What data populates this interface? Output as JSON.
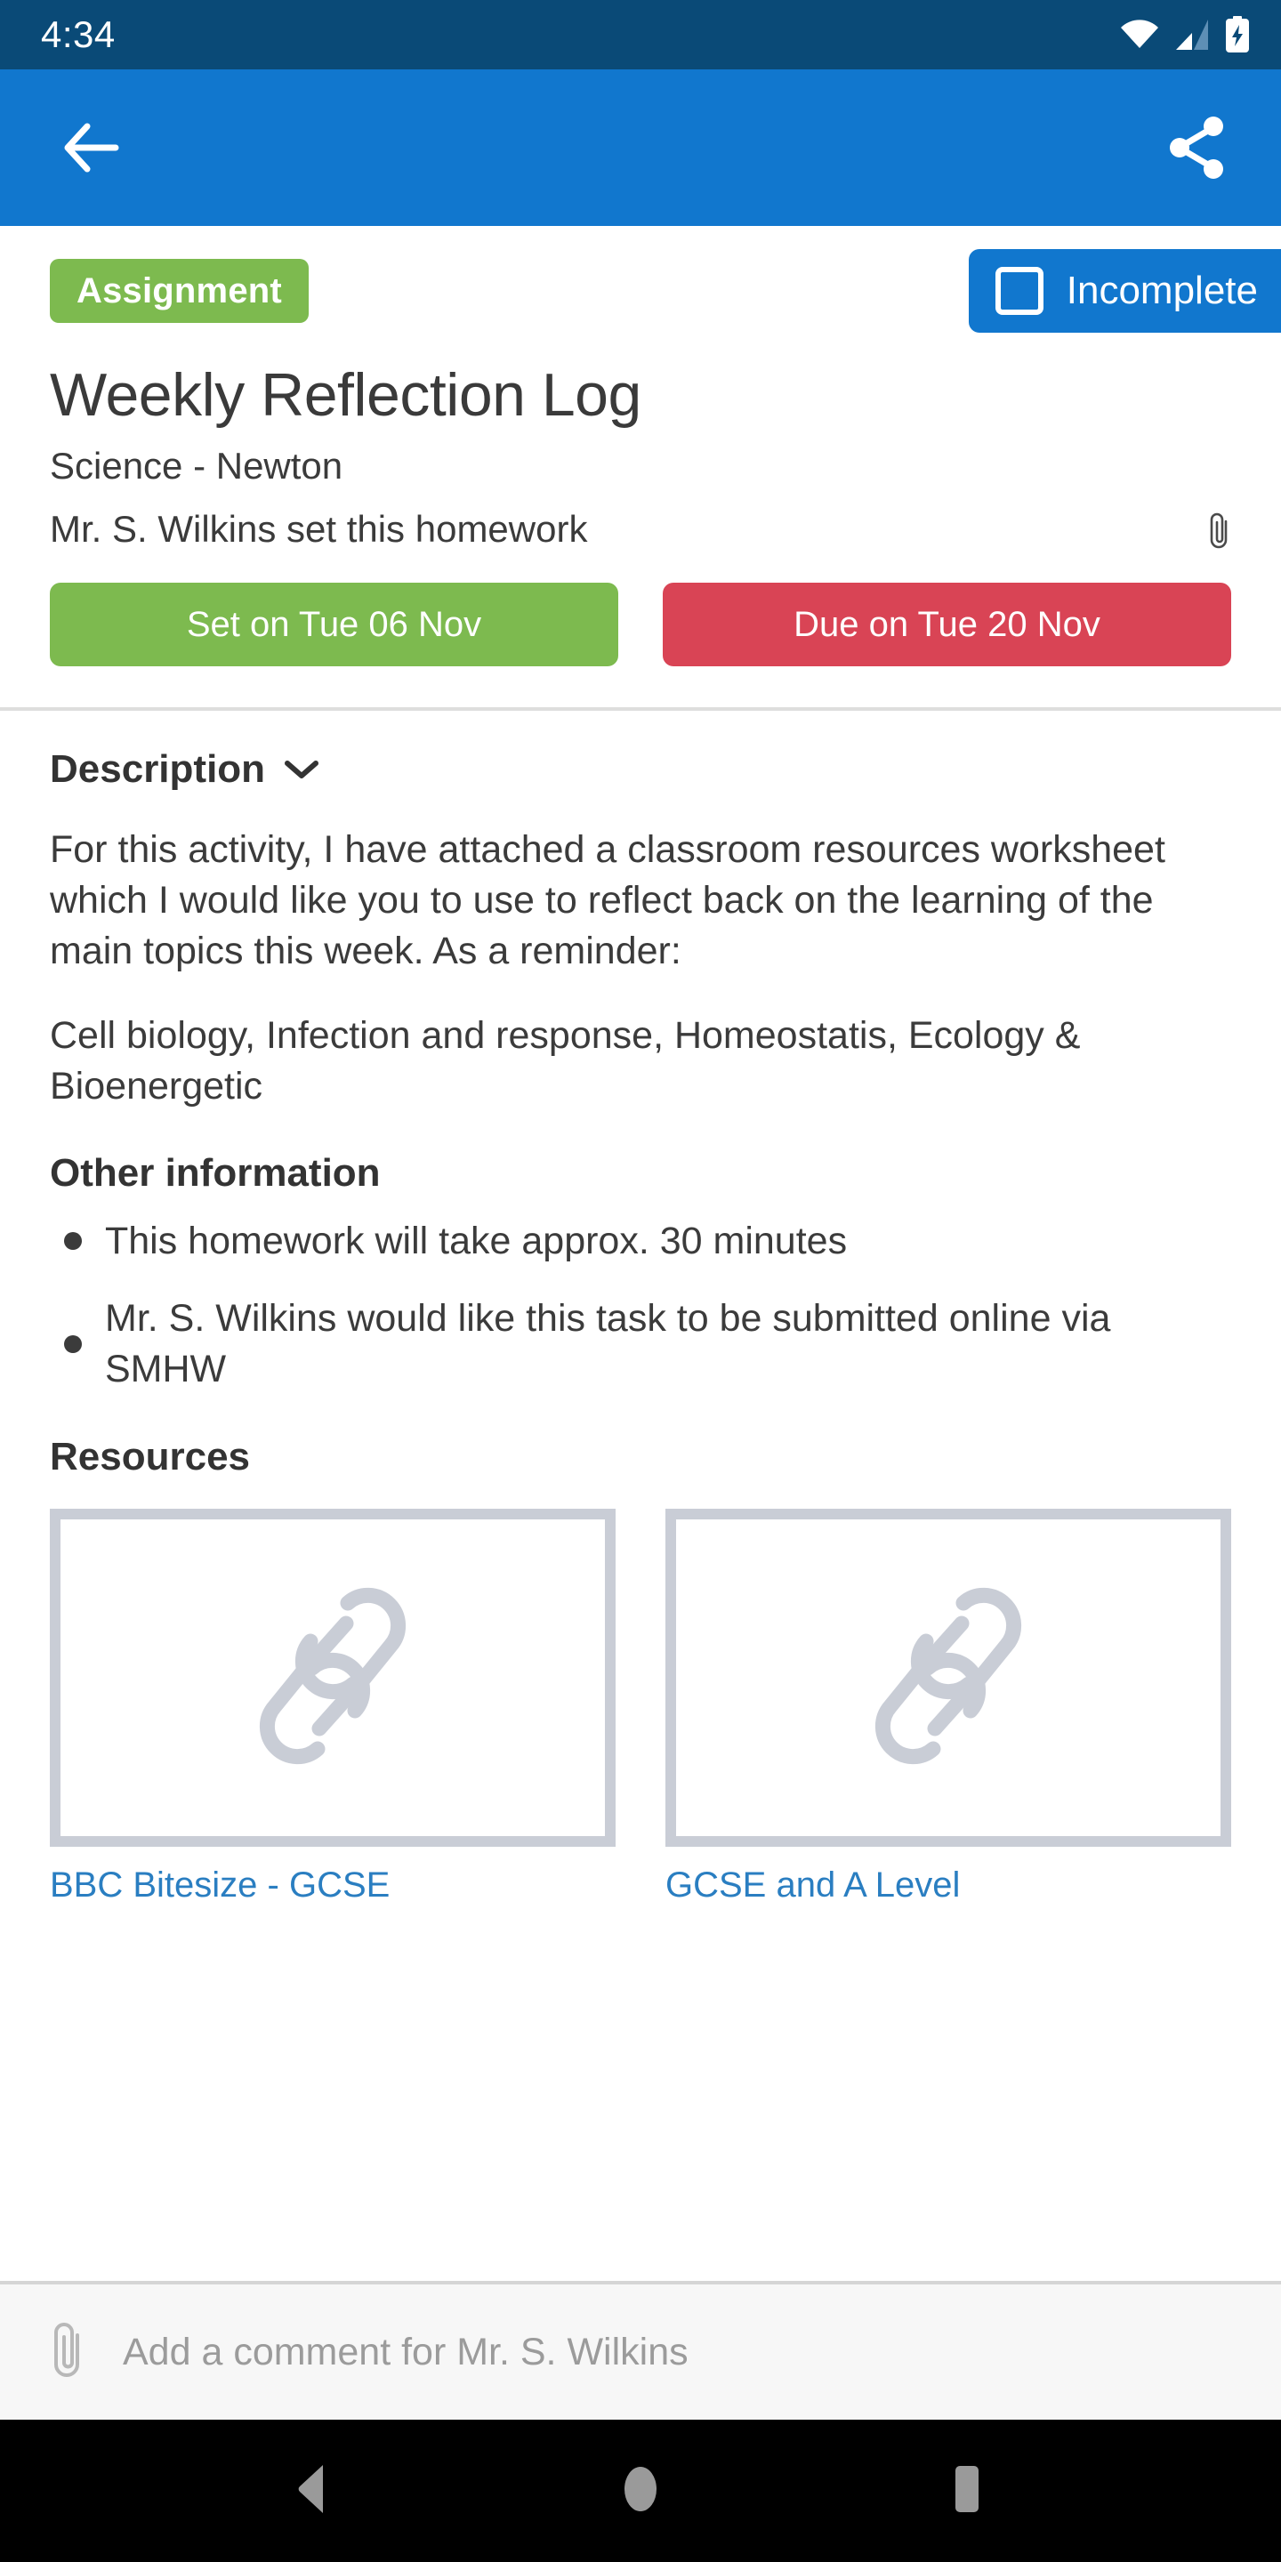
{
  "status_bar": {
    "time": "4:34",
    "icons": [
      "wifi-icon",
      "cellular-signal-icon",
      "battery-charging-icon"
    ],
    "background": "#0a4a77"
  },
  "app_bar": {
    "background": "#1177ce",
    "back_icon": "back-arrow-icon",
    "share_icon": "share-icon"
  },
  "homework": {
    "type_badge": "Assignment",
    "type_badge_color": "#7dba4f",
    "completion_status": "Incomplete",
    "completion_status_color": "#1177ce",
    "title": "Weekly Reflection Log",
    "subject": "Science - Newton",
    "setter_line": "Mr. S. Wilkins set this homework",
    "attachment_icon": "paperclip-icon",
    "set_date": "Set on Tue 06 Nov",
    "set_date_color": "#7dba4f",
    "due_date": "Due on Tue 20 Nov",
    "due_date_color": "#d94455"
  },
  "description": {
    "heading": "Description",
    "chevron": "chevron-down-icon",
    "paragraph_1": "For this activity, I have attached a classroom resources worksheet which I would like you to use to reflect back on the learning of the main topics this week. As a reminder:",
    "paragraph_2": "Cell biology, Infection and response, Homeostatis, Ecology & Bioenergetic"
  },
  "other_information": {
    "heading": "Other information",
    "items": [
      "This homework will take approx. 30 minutes",
      "Mr. S. Wilkins would like this task to be submitted online via SMHW"
    ]
  },
  "resources": {
    "heading": "Resources",
    "items": [
      {
        "label": "BBC Bitesize - GCSE",
        "icon": "link-chain-icon"
      },
      {
        "label": "GCSE and A Level",
        "icon": "link-chain-icon"
      }
    ],
    "link_color": "#2a7ec1"
  },
  "comment_bar": {
    "attach_icon": "paperclip-icon",
    "placeholder": "Add a comment for Mr. S. Wilkins"
  },
  "nav_bar": {
    "back": "nav-back-triangle-icon",
    "home": "nav-home-circle-icon",
    "recents": "nav-recents-square-icon"
  }
}
